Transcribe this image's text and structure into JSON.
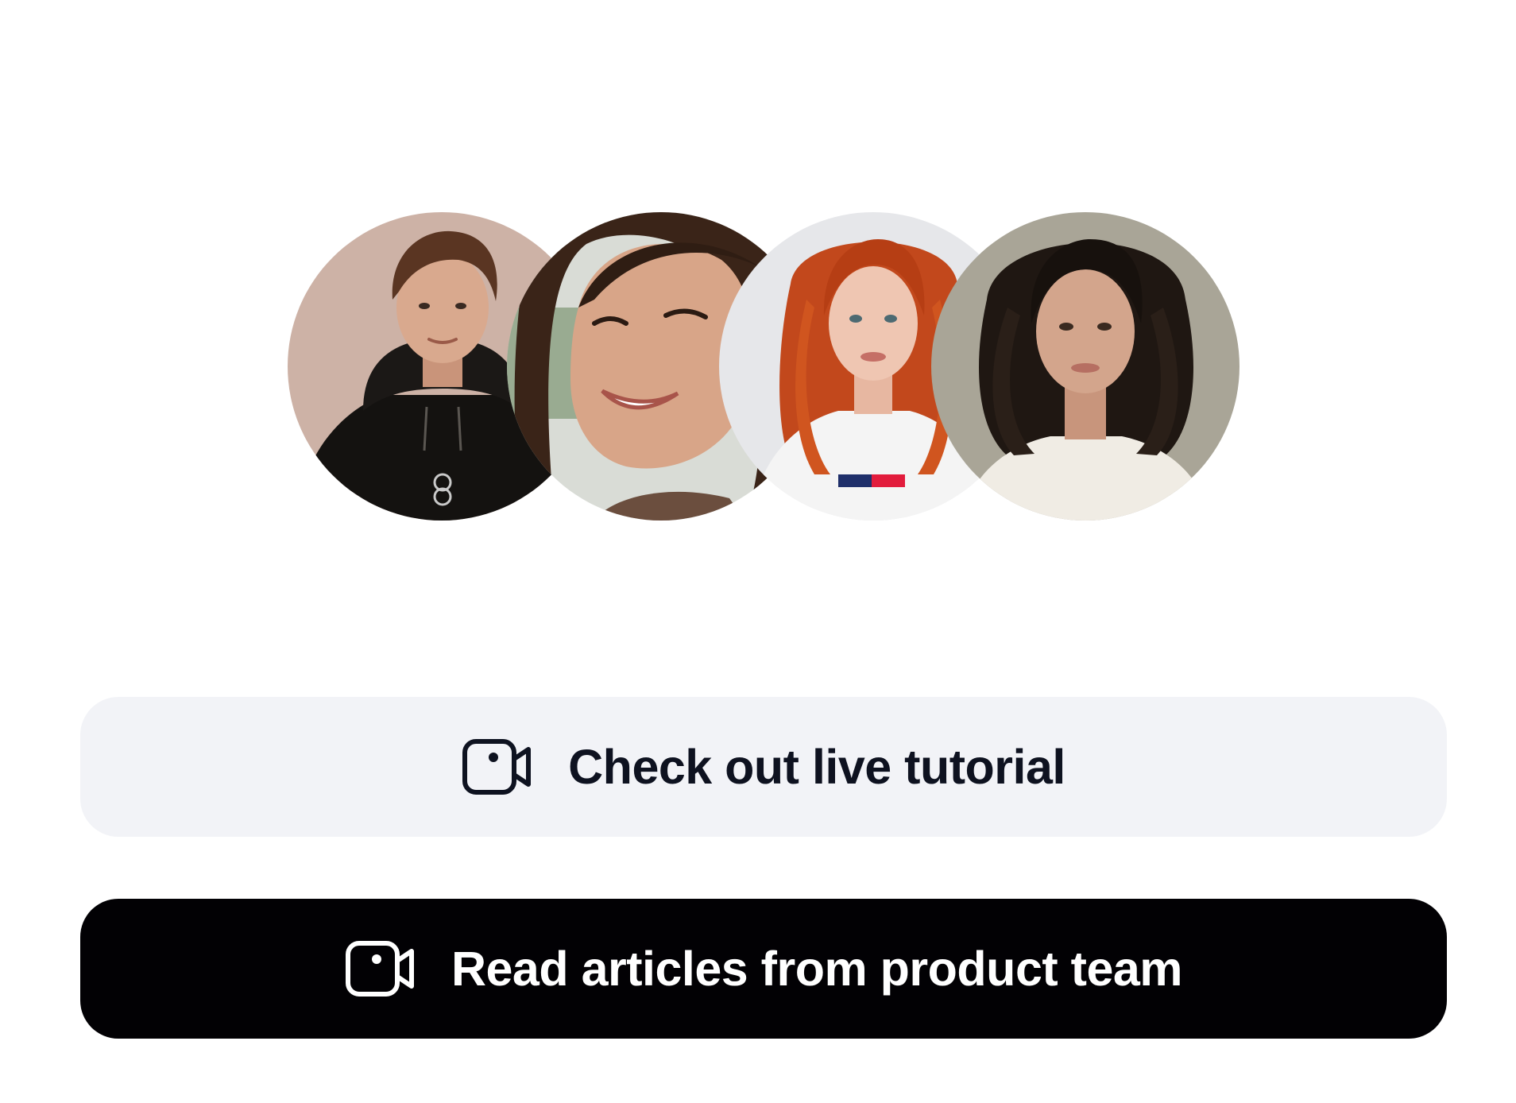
{
  "avatars": [
    {
      "name": "avatar-man-hoodie",
      "skin": "#d9a98e",
      "hair": "#5a3522",
      "bg": "#cdb2a6",
      "clothes": "#141210"
    },
    {
      "name": "avatar-woman-smiling",
      "skin": "#d8a588",
      "hair": "#3a2418",
      "bg": "#d9dcd6",
      "clothes": "#6b4e3e"
    },
    {
      "name": "avatar-woman-red-hair",
      "skin": "#efc6b2",
      "hair": "#c2481c",
      "bg": "#e6e7ea",
      "clothes": "#f4f4f4"
    },
    {
      "name": "avatar-woman-dark-wavy",
      "skin": "#d3a58c",
      "hair": "#1f1712",
      "bg": "#a9a597",
      "clothes": "#f0ece4"
    }
  ],
  "buttons": {
    "tutorial": {
      "label": "Check out live tutorial",
      "icon": "video-camera-icon",
      "background": "#f2f3f7",
      "text_color": "#0e1220"
    },
    "articles": {
      "label": "Read articles from product team",
      "icon": "video-camera-icon",
      "background": "#020104",
      "text_color": "#ffffff"
    }
  }
}
